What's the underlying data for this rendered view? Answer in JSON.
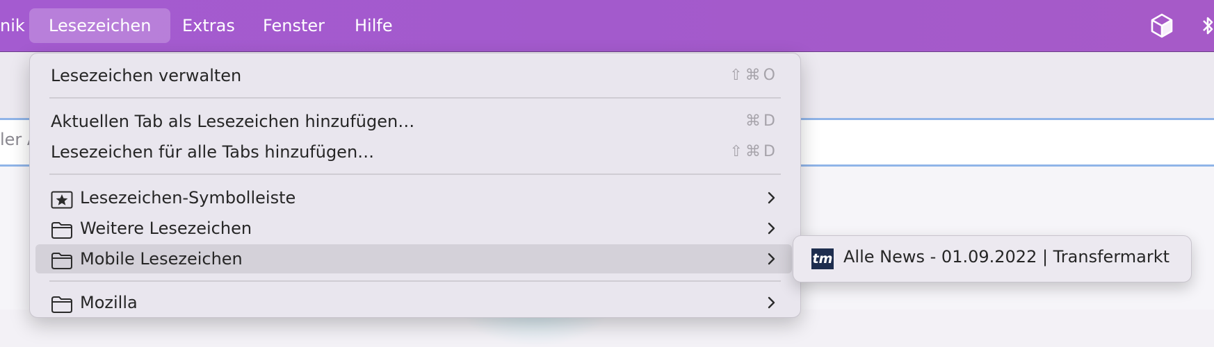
{
  "menubar": {
    "items": [
      {
        "label": "nik"
      },
      {
        "label": "Lesezeichen"
      },
      {
        "label": "Extras"
      },
      {
        "label": "Fenster"
      },
      {
        "label": "Hilfe"
      }
    ],
    "active_item": "Lesezeichen",
    "status_icons": [
      "box-3d-icon",
      "bluetooth-icon"
    ]
  },
  "background": {
    "urlbar_placeholder": "ler A"
  },
  "bookmarks_menu": {
    "items": [
      {
        "label": "Lesezeichen verwalten",
        "shortcut": "⇧⌘O"
      },
      {
        "label": "Aktuellen Tab als Lesezeichen hinzufügen…",
        "shortcut": "⌘D"
      },
      {
        "label": "Lesezeichen für alle Tabs hinzufügen…",
        "shortcut": "⇧⌘D"
      },
      {
        "label": "Lesezeichen-Symbolleiste",
        "icon": "star-box-icon",
        "submenu": true
      },
      {
        "label": "Weitere Lesezeichen",
        "icon": "folder-icon",
        "submenu": true
      },
      {
        "label": "Mobile Lesezeichen",
        "icon": "folder-icon",
        "submenu": true,
        "highlighted": true
      },
      {
        "label": "Mozilla",
        "icon": "folder-icon",
        "submenu": true
      }
    ]
  },
  "submenu": {
    "items": [
      {
        "favicon_text": "tm",
        "label": "Alle News - 01.09.2022 | Transfermarkt"
      }
    ]
  },
  "colors": {
    "menubar_purple": "#a45bd0",
    "menu_bg": "#e9e6ee",
    "highlight": "#d4d1d9",
    "favicon_navy": "#1d2d4e",
    "url_focus_ring": "#8fb4e8"
  }
}
